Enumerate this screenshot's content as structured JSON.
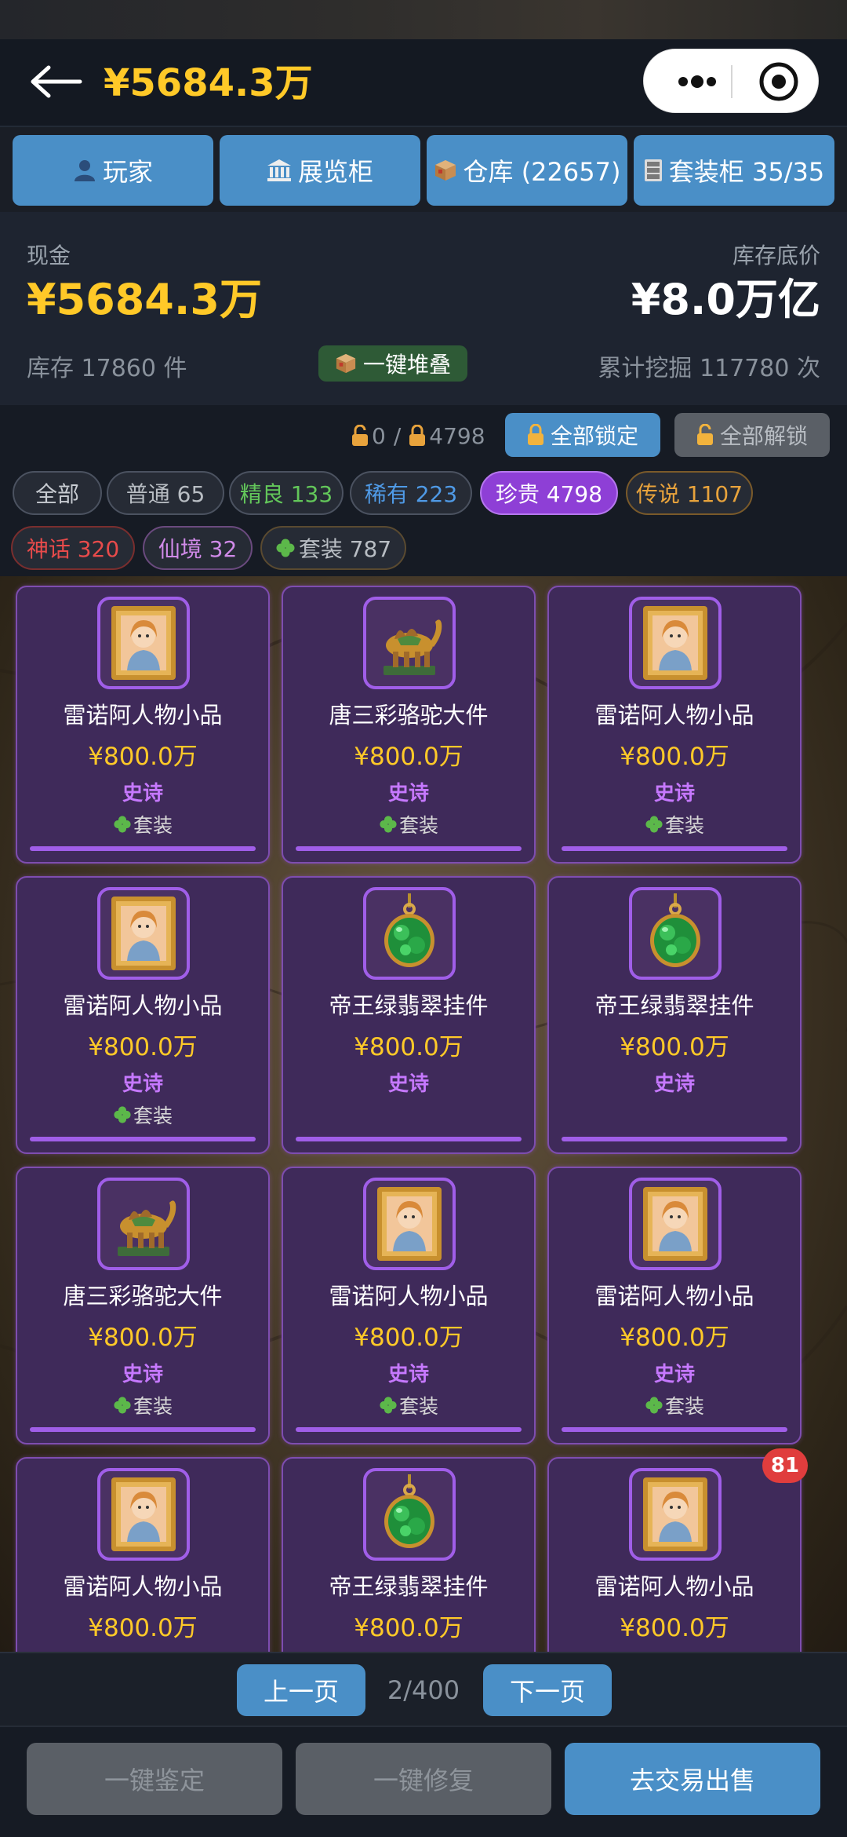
{
  "header": {
    "balance": "¥5684.3万"
  },
  "tabs": [
    {
      "label": "玩家",
      "icon": "person-icon"
    },
    {
      "label": "展览柜",
      "icon": "museum-icon"
    },
    {
      "label": "仓库 (22657)",
      "icon": "box-icon"
    },
    {
      "label": "套装柜 35/35",
      "icon": "cabinet-icon"
    }
  ],
  "summary": {
    "cash_label": "现金",
    "cash_value": "¥5684.3万",
    "floor_label": "库存底价",
    "floor_value": "¥8.0万亿",
    "stock_text": "库存 17860 件",
    "stack_label": "一键堆叠",
    "dig_text": "累计挖掘 117780 次"
  },
  "locks": {
    "unlocked_count": "0",
    "separator": "/",
    "locked_count": "4798",
    "lock_all_label": "全部锁定",
    "unlock_all_label": "全部解锁"
  },
  "filters": [
    {
      "label": "全部",
      "color": "#c8ccd2",
      "active": false
    },
    {
      "label": "普通 65",
      "color": "#b8bdc3",
      "active": false
    },
    {
      "label": "精良 133",
      "color": "#63c75a",
      "active": false
    },
    {
      "label": "稀有 223",
      "color": "#4f9ae6",
      "active": false
    },
    {
      "label": "珍贵 4798",
      "color": "#ffffff",
      "active": true
    },
    {
      "label": "传说 1107",
      "color": "#e8a33c",
      "active": false
    },
    {
      "label": "神话 320",
      "color": "#e84b4b",
      "active": false
    },
    {
      "label": "仙境 32",
      "color": "#d08ae8",
      "active": false
    },
    {
      "label": "套装 787",
      "color": "#b8bdc3",
      "active": false
    }
  ],
  "items": [
    {
      "name": "雷诺阿人物小品",
      "price": "¥800.0万",
      "rarity": "史诗",
      "set": "套装",
      "icon": "portrait-frame-icon"
    },
    {
      "name": "唐三彩骆驼大件",
      "price": "¥800.0万",
      "rarity": "史诗",
      "set": "套装",
      "icon": "camel-statue-icon"
    },
    {
      "name": "雷诺阿人物小品",
      "price": "¥800.0万",
      "rarity": "史诗",
      "set": "套装",
      "icon": "portrait-frame-icon"
    },
    {
      "name": "雷诺阿人物小品",
      "price": "¥800.0万",
      "rarity": "史诗",
      "set": "套装",
      "icon": "portrait-frame-icon"
    },
    {
      "name": "帝王绿翡翠挂件",
      "price": "¥800.0万",
      "rarity": "史诗",
      "set": "",
      "icon": "jade-pendant-icon"
    },
    {
      "name": "帝王绿翡翠挂件",
      "price": "¥800.0万",
      "rarity": "史诗",
      "set": "",
      "icon": "jade-pendant-icon"
    },
    {
      "name": "唐三彩骆驼大件",
      "price": "¥800.0万",
      "rarity": "史诗",
      "set": "套装",
      "icon": "camel-statue-icon"
    },
    {
      "name": "雷诺阿人物小品",
      "price": "¥800.0万",
      "rarity": "史诗",
      "set": "套装",
      "icon": "portrait-frame-icon"
    },
    {
      "name": "雷诺阿人物小品",
      "price": "¥800.0万",
      "rarity": "史诗",
      "set": "套装",
      "icon": "portrait-frame-icon"
    },
    {
      "name": "雷诺阿人物小品",
      "price": "¥800.0万",
      "rarity": "",
      "set": "",
      "icon": "portrait-frame-icon"
    },
    {
      "name": "帝王绿翡翠挂件",
      "price": "¥800.0万",
      "rarity": "",
      "set": "",
      "icon": "jade-pendant-icon"
    },
    {
      "name": "雷诺阿人物小品",
      "price": "¥800.0万",
      "rarity": "",
      "set": "",
      "icon": "portrait-frame-icon"
    }
  ],
  "badge_count": "81",
  "pager": {
    "prev_label": "上一页",
    "page_text": "2/400",
    "next_label": "下一页"
  },
  "footer": {
    "appraise_label": "一键鉴定",
    "repair_label": "一键修复",
    "sell_label": "去交易出售"
  },
  "colors": {
    "gold": "#ffc928",
    "accent_blue": "#4a8fc7",
    "epic_purple": "#a05ee8"
  }
}
